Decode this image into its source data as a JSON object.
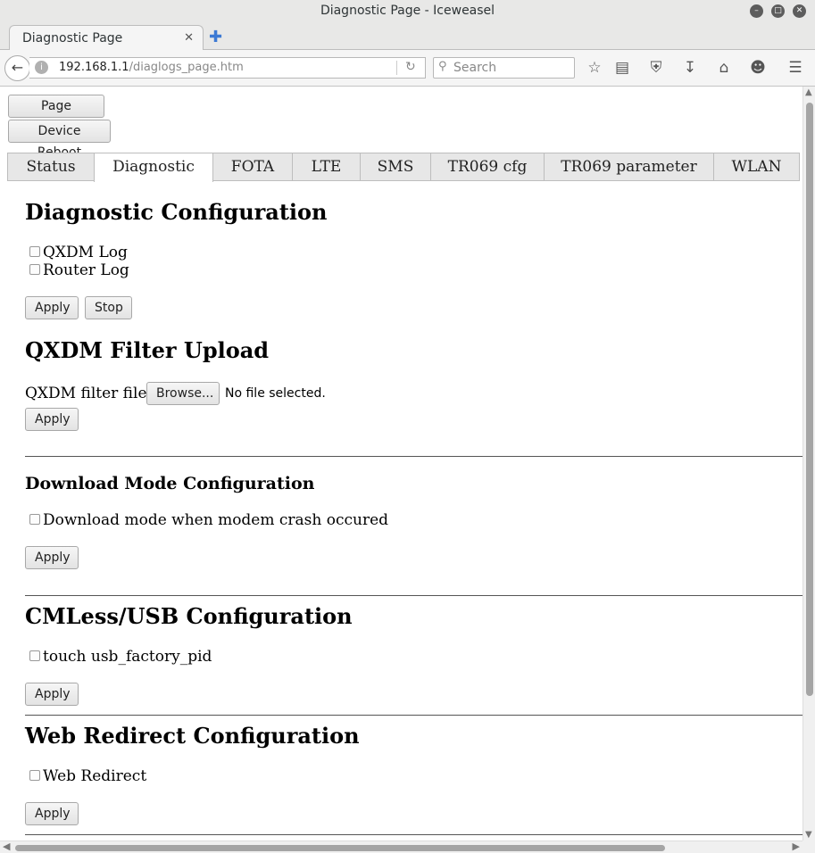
{
  "window": {
    "title": "Diagnostic Page - Iceweasel",
    "controls": [
      "minimize",
      "maximize",
      "close"
    ]
  },
  "browser": {
    "tab_title": "Diagnostic Page",
    "url_host": "192.168.1.1",
    "url_path": "/diaglogs_page.htm",
    "search_placeholder": "Search"
  },
  "page": {
    "refresh_button": "Page Refresh",
    "reboot_button": "Device Reboot",
    "tabs": [
      "Status",
      "Diagnostic",
      "FOTA",
      "LTE",
      "SMS",
      "TR069 cfg",
      "TR069 parameter",
      "WLAN"
    ],
    "active_tab": "Diagnostic",
    "sections": {
      "diagnostic_config": {
        "heading": "Diagnostic Configuration",
        "options": [
          "QXDM Log",
          "Router Log"
        ],
        "apply": "Apply",
        "stop": "Stop"
      },
      "qxdm_filter": {
        "heading": "QXDM Filter Upload",
        "file_label": "QXDM filter file:",
        "browse": "Browse...",
        "no_file": "No file selected.",
        "apply": "Apply"
      },
      "download_mode": {
        "heading": "Download Mode Configuration",
        "option": "Download mode when modem crash occured",
        "apply": "Apply"
      },
      "cmless_usb": {
        "heading": "CMLess/USB Configuration",
        "option": "touch usb_factory_pid",
        "apply": "Apply"
      },
      "web_redirect": {
        "heading": "Web Redirect Configuration",
        "option": "Web Redirect",
        "apply": "Apply"
      }
    }
  }
}
